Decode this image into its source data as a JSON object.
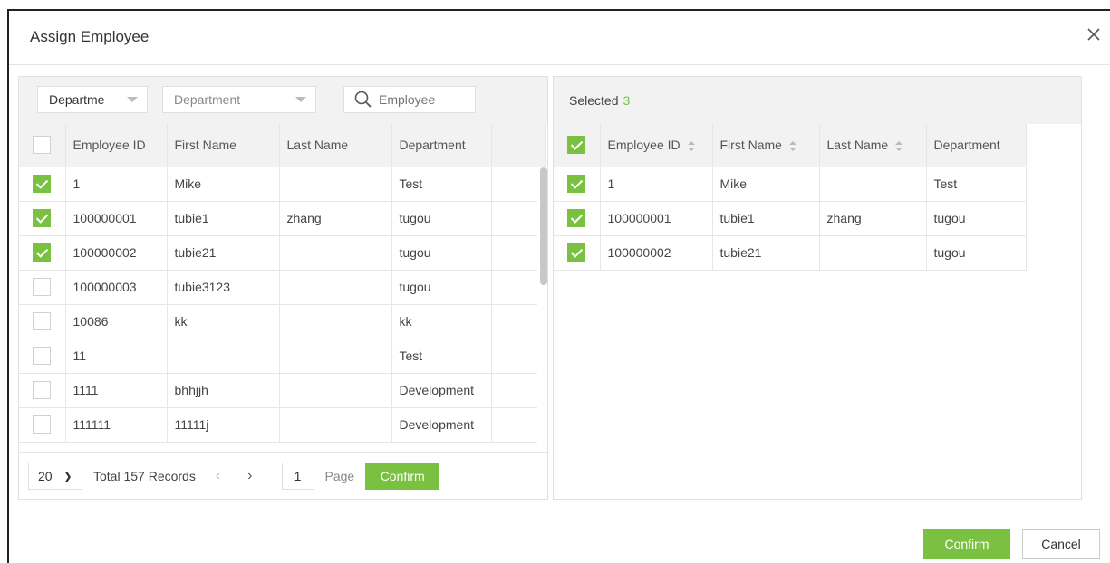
{
  "dialog": {
    "title": "Assign Employee",
    "close_icon": "close-icon"
  },
  "filters": {
    "dept_select_value": "Departme",
    "dept_select_placeholder": "Department",
    "employee_search_placeholder": "Employee"
  },
  "left_table": {
    "columns": [
      "Employee ID",
      "First Name",
      "Last Name",
      "Department"
    ],
    "rows": [
      {
        "checked": true,
        "id": "1",
        "first": "Mike",
        "last": "",
        "dept": "Test"
      },
      {
        "checked": true,
        "id": "100000001",
        "first": "tubie1",
        "last": "zhang",
        "dept": "tugou"
      },
      {
        "checked": true,
        "id": "100000002",
        "first": "tubie21",
        "last": "",
        "dept": "tugou"
      },
      {
        "checked": false,
        "id": "100000003",
        "first": "tubie3123",
        "last": "",
        "dept": "tugou"
      },
      {
        "checked": false,
        "id": "10086",
        "first": "kk",
        "last": "",
        "dept": "kk"
      },
      {
        "checked": false,
        "id": "11",
        "first": "",
        "last": "",
        "dept": "Test"
      },
      {
        "checked": false,
        "id": "1111",
        "first": "bhhjjh",
        "last": "",
        "dept": "Development"
      },
      {
        "checked": false,
        "id": "111111",
        "first": "11111j",
        "last": "",
        "dept": "Development"
      }
    ]
  },
  "pager": {
    "page_size": "20",
    "total_text": "Total 157 Records",
    "prev": "‹",
    "next": "›",
    "page_number": "1",
    "page_label": "Page",
    "confirm_label": "Confirm"
  },
  "selected": {
    "label": "Selected",
    "count": "3",
    "columns": [
      "Employee ID",
      "First Name",
      "Last Name",
      "Department"
    ],
    "rows": [
      {
        "id": "1",
        "first": "Mike",
        "last": "",
        "dept": "Test"
      },
      {
        "id": "100000001",
        "first": "tubie1",
        "last": "zhang",
        "dept": "tugou"
      },
      {
        "id": "100000002",
        "first": "tubie21",
        "last": "",
        "dept": "tugou"
      }
    ]
  },
  "footer": {
    "confirm_label": "Confirm",
    "cancel_label": "Cancel"
  },
  "colors": {
    "accent_green": "#7ac142",
    "header_bg": "#f2f2f2"
  }
}
